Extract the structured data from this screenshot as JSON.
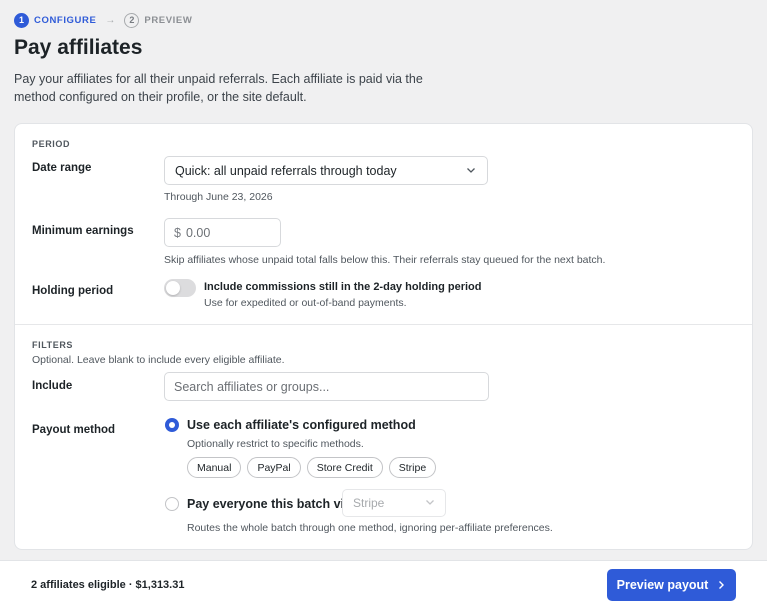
{
  "stepper": {
    "steps": [
      {
        "number": "1",
        "label": "CONFIGURE"
      },
      {
        "number": "2",
        "label": "PREVIEW"
      }
    ]
  },
  "page": {
    "title": "Pay affiliates",
    "description": "Pay your affiliates for all their unpaid referrals. Each affiliate is paid via the method configured on their profile, or the site default."
  },
  "period": {
    "section_title": "PERIOD",
    "date_range": {
      "label": "Date range",
      "value": "Quick: all unpaid referrals through today",
      "helper": "Through June 23, 2026"
    },
    "minimum_earnings": {
      "label": "Minimum earnings",
      "currency": "$",
      "placeholder": "0.00",
      "helper": "Skip affiliates whose unpaid total falls below this. Their referrals stay queued for the next batch."
    },
    "holding_period": {
      "label": "Holding period",
      "toggle_label": "Include commissions still in the 2-day holding period",
      "helper": "Use for expedited or out-of-band payments."
    }
  },
  "filters": {
    "section_title": "FILTERS",
    "description": "Optional. Leave blank to include every eligible affiliate.",
    "include": {
      "label": "Include",
      "placeholder": "Search affiliates or groups..."
    },
    "payout_method": {
      "label": "Payout method",
      "option_configured": {
        "label": "Use each affiliate's configured method",
        "helper": "Optionally restrict to specific methods."
      },
      "chips": [
        "Manual",
        "PayPal",
        "Store Credit",
        "Stripe"
      ],
      "option_everyone": {
        "label": "Pay everyone this batch via",
        "select_value": "Stripe",
        "helper": "Routes the whole batch through one method, ignoring per-affiliate preferences."
      }
    }
  },
  "footer": {
    "summary": "2 affiliates eligible · $1,313.31",
    "preview_label": "Preview payout"
  },
  "colors": {
    "accent": "#2f5bd8",
    "background": "#f0f0f1"
  }
}
